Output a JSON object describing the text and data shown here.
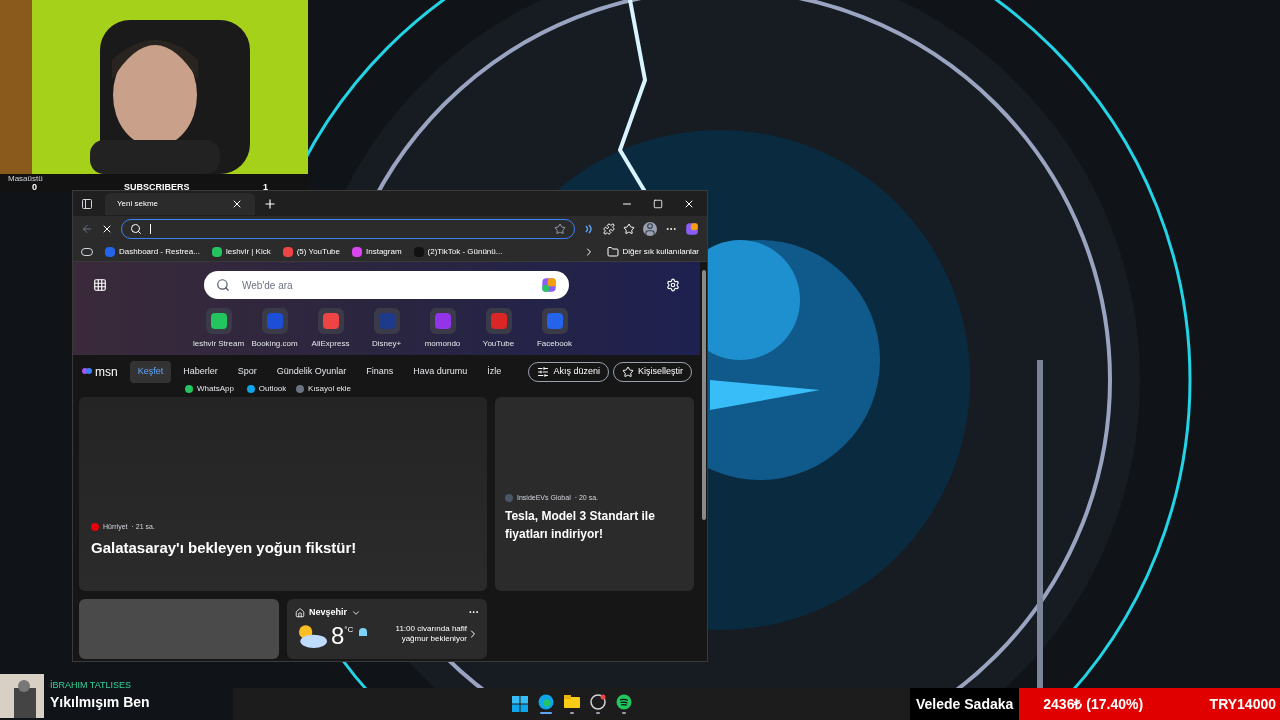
{
  "webcam": {
    "kind": "picture",
    "desktop_label": "Masaüstü",
    "left_count": "0",
    "subscribers_label": "SUBSCRIBERS",
    "subscribers_count": "1"
  },
  "browser": {
    "tab_title": "Yeni sekme",
    "bookmarks": [
      {
        "label": "Dashboard - Restrea...",
        "color": "#2563eb"
      },
      {
        "label": "leshvlr | Kick",
        "color": "#22c55e"
      },
      {
        "label": "(5) YouTube",
        "color": "#ef4444"
      },
      {
        "label": "Instagram",
        "color": "#d946ef"
      },
      {
        "label": "(2)TikTok - Gününü...",
        "color": "#111111"
      }
    ],
    "other_bookmarks": "Diğer sık kullanılanlar"
  },
  "newtab": {
    "search_placeholder": "Web'de ara",
    "shortcuts": [
      {
        "label": "leshvlr Stream",
        "color": "#22c55e"
      },
      {
        "label": "Booking.com",
        "color": "#1d4ed8"
      },
      {
        "label": "AliExpress",
        "color": "#ef4444"
      },
      {
        "label": "Disney+",
        "color": "#1e3a8a"
      },
      {
        "label": "momondo",
        "color": "#9333ea"
      },
      {
        "label": "YouTube",
        "color": "#dc2626"
      },
      {
        "label": "Facebook",
        "color": "#2563eb"
      }
    ],
    "shortcuts_row2": [
      {
        "label": "WhatsApp",
        "color": "#22c55e"
      },
      {
        "label": "Outlook",
        "color": "#0ea5e9"
      },
      {
        "label": "Kısayol ekle",
        "color": "#6b7280"
      }
    ],
    "msn_logo": "msn",
    "nav": [
      {
        "label": "Keşfet",
        "selected": true
      },
      {
        "label": "Haberler",
        "selected": false
      },
      {
        "label": "Spor",
        "selected": false
      },
      {
        "label": "Gündelik Oyunlar",
        "selected": false
      },
      {
        "label": "Finans",
        "selected": false
      },
      {
        "label": "Hava durumu",
        "selected": false
      },
      {
        "label": "İzle",
        "selected": false
      }
    ],
    "feed_button": "Akış düzeni",
    "personalize_button": "Kişiselleştir",
    "cards": [
      {
        "source": "Hürriyet",
        "time": "· 21 sa.",
        "title": "Galatasaray'ı bekleyen yoğun fikstür!"
      },
      {
        "source": "InsideEVs Global",
        "time": "· 20 sa.",
        "title": "Tesla, Model 3 Standart ile fiyatları indiriyor!"
      }
    ],
    "weather": {
      "location": "Nevşehir",
      "more": "···",
      "temperature": "8",
      "unit": "°C",
      "forecast": "11:00 civarında hafif yağmur bekleniyor"
    }
  },
  "music": {
    "artist": "İBRAHIM TATLISES",
    "title": "Yıkılmışım Ben"
  },
  "taskbar": [
    {
      "kind": "start"
    },
    {
      "kind": "edge",
      "active": true
    },
    {
      "kind": "folder",
      "active": false
    },
    {
      "kind": "obs",
      "active": false
    },
    {
      "kind": "spotify",
      "active": false
    }
  ],
  "donation": {
    "name": "Velede Sadaka",
    "amount": "2436₺ (17.40%)",
    "goal": "TRY14000"
  }
}
